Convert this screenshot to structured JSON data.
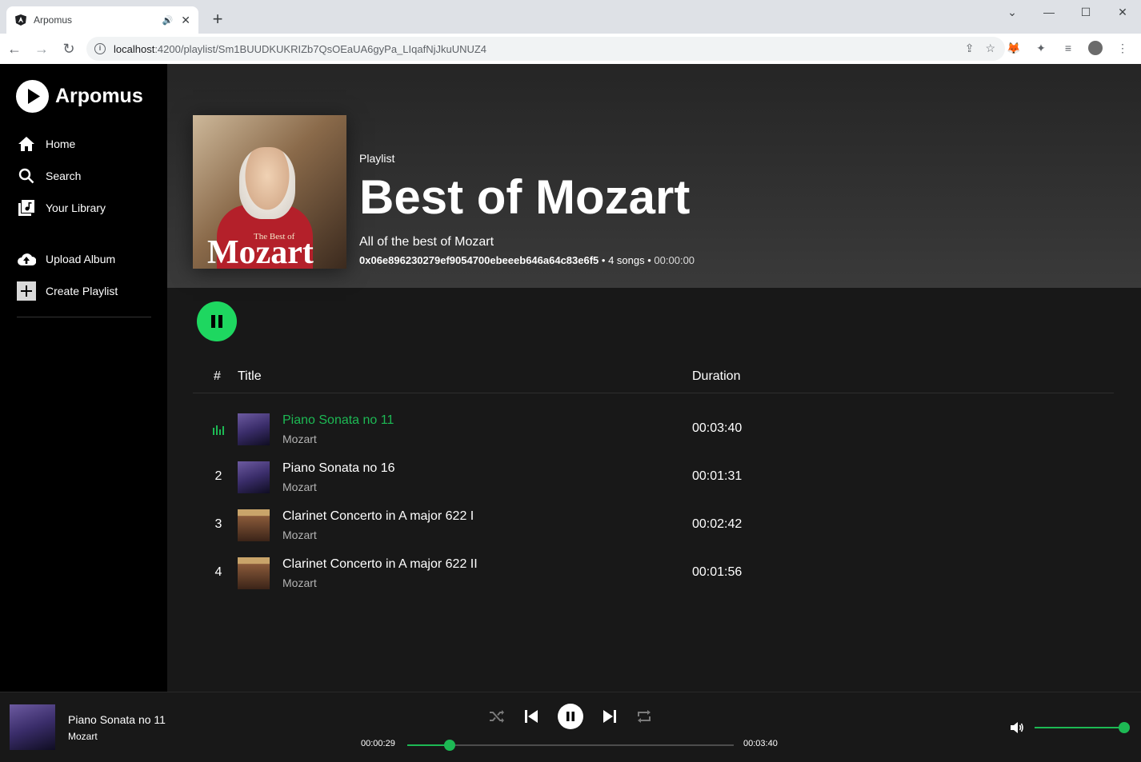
{
  "browser": {
    "tab_title": "Arpomus",
    "new_tab_label": "+",
    "url_host": "localhost",
    "url_path": ":4200/playlist/Sm1BUUDKUKRIZb7QsOEaUA6gyPa_LIqafNjJkuUNUZ4"
  },
  "sidebar": {
    "brand": "Arpomus",
    "items": [
      {
        "label": "Home",
        "icon": "home-icon"
      },
      {
        "label": "Search",
        "icon": "search-icon"
      },
      {
        "label": "Your Library",
        "icon": "library-icon"
      },
      {
        "label": "Upload Album",
        "icon": "cloud-upload-icon"
      },
      {
        "label": "Create Playlist",
        "icon": "plus-box-icon"
      }
    ]
  },
  "playlist": {
    "type_label": "Playlist",
    "title": "Best of Mozart",
    "description": "All of the best of Mozart",
    "owner": "0x06e896230279ef9054700ebeeeb646a64c83e6f5",
    "song_count": "4 songs",
    "total_duration": "00:00:00",
    "cover_small_text": "The Best of",
    "cover_big_text": "Mozart"
  },
  "table": {
    "col_num": "#",
    "col_title": "Title",
    "col_duration": "Duration",
    "rows": [
      {
        "num": "",
        "title": "Piano Sonata no 11",
        "artist": "Mozart",
        "duration": "00:03:40",
        "playing": true
      },
      {
        "num": "2",
        "title": "Piano Sonata no 16",
        "artist": "Mozart",
        "duration": "00:01:31",
        "playing": false
      },
      {
        "num": "3",
        "title": "Clarinet Concerto in A major 622 I",
        "artist": "Mozart",
        "duration": "00:02:42",
        "playing": false
      },
      {
        "num": "4",
        "title": "Clarinet Concerto in A major 622 II",
        "artist": "Mozart",
        "duration": "00:01:56",
        "playing": false
      }
    ]
  },
  "player": {
    "now_playing_title": "Piano Sonata no 11",
    "now_playing_artist": "Mozart",
    "elapsed": "00:00:29",
    "total": "00:03:40",
    "progress_fraction": 0.13,
    "volume_fraction": 1.0
  },
  "colors": {
    "accent": "#1db954",
    "sidebar_bg": "#000000",
    "main_bg": "#181818"
  }
}
